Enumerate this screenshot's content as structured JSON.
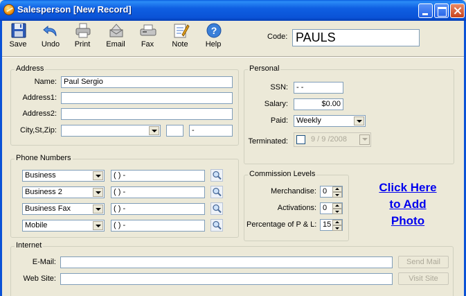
{
  "window": {
    "title": "Salesperson [New Record]"
  },
  "toolbar": {
    "save": "Save",
    "undo": "Undo",
    "print": "Print",
    "email": "Email",
    "fax": "Fax",
    "note": "Note",
    "help": "Help"
  },
  "code": {
    "label": "Code:",
    "value": "PAULS"
  },
  "address": {
    "title": "Address",
    "name_label": "Name:",
    "name_value": "Paul Sergio",
    "address1_label": "Address1:",
    "address1_value": "",
    "address2_label": "Address2:",
    "address2_value": "",
    "csz_label": "City,St,Zip:",
    "city_value": "",
    "state_value": "",
    "zip_value": "     -"
  },
  "phones": {
    "title": "Phone Numbers",
    "rows": [
      {
        "type": "Business",
        "number": "(   )    -"
      },
      {
        "type": "Business 2",
        "number": "(   )    -"
      },
      {
        "type": "Business Fax",
        "number": "(   )    -"
      },
      {
        "type": "Mobile",
        "number": "(   )    -"
      }
    ]
  },
  "personal": {
    "title": "Personal",
    "ssn_label": "SSN:",
    "ssn_value": "   -  -",
    "salary_label": "Salary:",
    "salary_value": "$0.00",
    "paid_label": "Paid:",
    "paid_value": "Weekly",
    "terminated_label": "Terminated:",
    "terminated_value": "9 / 9 /2008",
    "terminated_checked": false
  },
  "commission": {
    "title": "Commission Levels",
    "merch_label": "Merchandise:",
    "merch_value": "0",
    "act_label": "Activations:",
    "act_value": "0",
    "pl_label": "Percentage of P & L:",
    "pl_value": "15"
  },
  "photo": {
    "line1": "Click Here",
    "line2": "to Add",
    "line3": "Photo"
  },
  "internet": {
    "title": "Internet",
    "email_label": "E-Mail:",
    "email_value": "",
    "web_label": "Web Site:",
    "web_value": "",
    "send_mail": "Send Mail",
    "visit_site": "Visit Site"
  }
}
